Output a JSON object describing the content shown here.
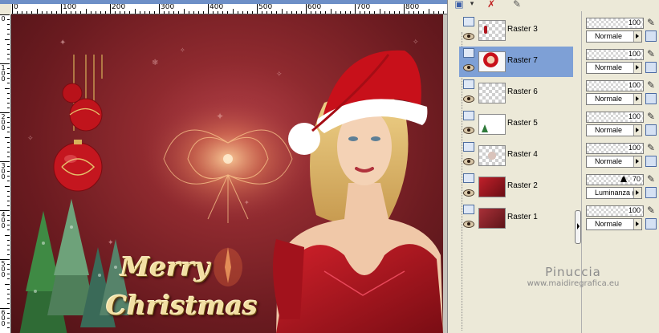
{
  "ruler": {
    "top_labels": [
      "0",
      "100",
      "200",
      "300",
      "400",
      "500",
      "600",
      "700",
      "800"
    ],
    "left_labels": [
      "0",
      "100",
      "200",
      "300",
      "400",
      "500",
      "600"
    ]
  },
  "image": {
    "greeting_line1": "Merry",
    "greeting_line2": "Christmas",
    "watermark_name": "Pinuccia",
    "watermark_url": "www.maidiregrafica.eu"
  },
  "layers": [
    {
      "name": "Raster 3",
      "opacity": "100",
      "mode": "Normale",
      "selected": false,
      "thumb": "empty"
    },
    {
      "name": "Raster 7",
      "opacity": "100",
      "mode": "Normale",
      "selected": true,
      "thumb": "woman"
    },
    {
      "name": "Raster 6",
      "opacity": "100",
      "mode": "Normale",
      "selected": false,
      "thumb": "empty"
    },
    {
      "name": "Raster 5",
      "opacity": "100",
      "mode": "Normale",
      "selected": false,
      "thumb": "trees"
    },
    {
      "name": "Raster 4",
      "opacity": "100",
      "mode": "Normale",
      "selected": false,
      "thumb": "sparkles"
    },
    {
      "name": "Raster 2",
      "opacity": "70",
      "mode": "Luminanza (L)",
      "selected": false,
      "thumb": "red"
    },
    {
      "name": "Raster 1",
      "opacity": "100",
      "mode": "Normale",
      "selected": false,
      "thumb": "red-dark"
    }
  ],
  "icons": {
    "layer_type": "raster-layer-icon",
    "visibility": "eye-icon",
    "brush": "paintbrush-icon",
    "lock": "lock-icon",
    "toolbar": [
      "new-layer-icon",
      "delete-layer-icon",
      "edit-icon"
    ]
  },
  "colors": {
    "selection": "#7ea0d6",
    "panel": "#ece9d8",
    "canvas_red": "#8f2a2f",
    "gold_text": "#f2dfa3"
  }
}
